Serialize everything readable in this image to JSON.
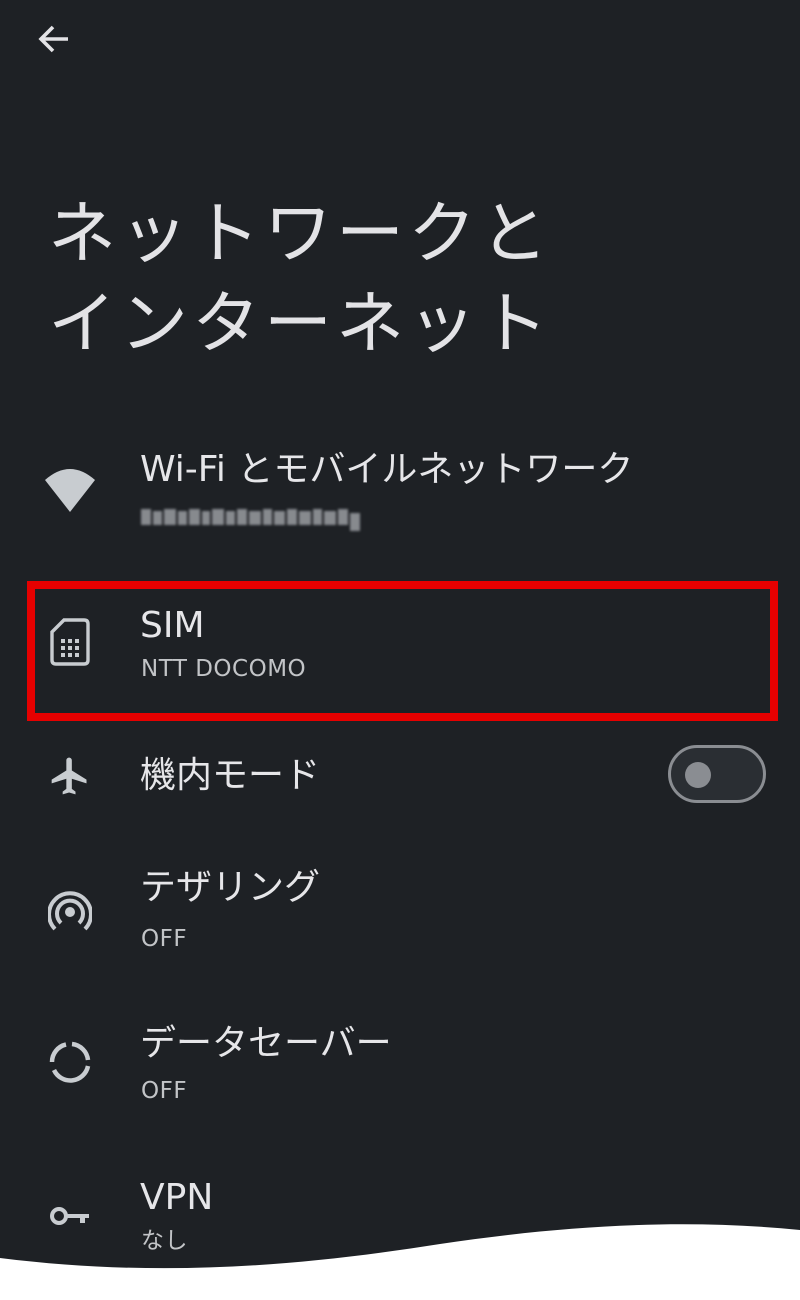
{
  "header": {
    "back_label": "back",
    "title_line1": "ネットワークと",
    "title_line2": "インターネット"
  },
  "items": [
    {
      "id": "wifi",
      "title": "Wi-Fi とモバイルネットワーク",
      "subtitle": "",
      "subtitle_obscured": true,
      "icon": "wifi-icon"
    },
    {
      "id": "sim",
      "title": "SIM",
      "subtitle": "NTT DOCOMO",
      "icon": "sim-card-icon",
      "highlighted": true
    },
    {
      "id": "airplane",
      "title": "機内モード",
      "icon": "airplane-icon",
      "toggle": false
    },
    {
      "id": "tethering",
      "title": "テザリング",
      "subtitle": "OFF",
      "icon": "hotspot-icon"
    },
    {
      "id": "datasaver",
      "title": "データセーバー",
      "subtitle": "OFF",
      "icon": "data-saver-icon"
    },
    {
      "id": "vpn",
      "title": "VPN",
      "subtitle": "なし",
      "icon": "vpn-key-icon"
    }
  ],
  "colors": {
    "background": "#1e2125",
    "text_primary": "#e6e6e9",
    "text_secondary": "#c2c4c7",
    "icon": "#c8ccd0",
    "highlight": "#e60000",
    "toggle_off": "#8a8d92"
  }
}
